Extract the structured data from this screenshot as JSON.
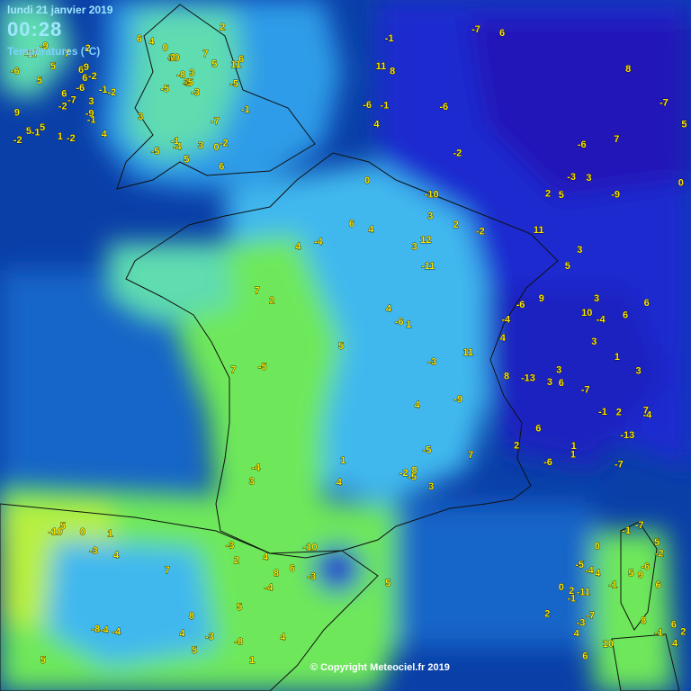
{
  "header": {
    "date": "lundi 21 janvier 2019",
    "time": "00:28",
    "unit_label": "Températures (°C)"
  },
  "footer": {
    "credit": "© Copyright Meteociel.fr 2019"
  },
  "colors": {
    "sea_deep": "#0a3fa8",
    "sea_mid": "#1565c8",
    "very_cold": "#1a2ad0",
    "cold": "#2f7fe8",
    "cool": "#41b8ee",
    "mild": "#5fdcb0",
    "warm_green": "#6ee85a",
    "lime": "#b8f03c",
    "label": "#ffe800"
  },
  "map_data": {
    "region": "France",
    "observations": [
      {
        "v": "5"
      },
      {
        "v": "5"
      },
      {
        "v": "4"
      },
      {
        "v": "2"
      },
      {
        "v": "4"
      },
      {
        "v": "6"
      },
      {
        "v": "5"
      },
      {
        "v": "7"
      },
      {
        "v": "3"
      },
      {
        "v": "7"
      },
      {
        "v": "8"
      },
      {
        "v": "6"
      },
      {
        "v": "5"
      },
      {
        "v": "4"
      },
      {
        "v": "3"
      },
      {
        "v": "8"
      },
      {
        "v": "2"
      },
      {
        "v": "3"
      },
      {
        "v": "5"
      },
      {
        "v": "9"
      },
      {
        "v": "10"
      },
      {
        "v": "11"
      },
      {
        "v": "11"
      },
      {
        "v": "12"
      },
      {
        "v": "10"
      },
      {
        "v": "8"
      },
      {
        "v": "6"
      },
      {
        "v": "4"
      },
      {
        "v": "5"
      },
      {
        "v": "6"
      },
      {
        "v": "4"
      },
      {
        "v": "3"
      },
      {
        "v": "4"
      },
      {
        "v": "5"
      },
      {
        "v": "6"
      },
      {
        "v": "3"
      },
      {
        "v": "5"
      },
      {
        "v": "7"
      },
      {
        "v": "6"
      },
      {
        "v": "4"
      },
      {
        "v": "1"
      },
      {
        "v": "2"
      },
      {
        "v": "-1"
      },
      {
        "v": "0"
      },
      {
        "v": "1"
      },
      {
        "v": "2"
      },
      {
        "v": "-4"
      },
      {
        "v": "-2"
      },
      {
        "v": "-1"
      },
      {
        "v": "0"
      },
      {
        "v": "2"
      },
      {
        "v": "3"
      },
      {
        "v": "4"
      },
      {
        "v": "4"
      },
      {
        "v": "5"
      },
      {
        "v": "4"
      },
      {
        "v": "-3"
      },
      {
        "v": "-6"
      },
      {
        "v": "-5"
      },
      {
        "v": "-7"
      },
      {
        "v": "-8"
      },
      {
        "v": "-9"
      },
      {
        "v": "-11"
      },
      {
        "v": "-7"
      },
      {
        "v": "-6"
      },
      {
        "v": "-5"
      },
      {
        "v": "-4"
      },
      {
        "v": "-3"
      },
      {
        "v": "-6"
      },
      {
        "v": "-7"
      },
      {
        "v": "-8"
      },
      {
        "v": "-6"
      },
      {
        "v": "-5"
      },
      {
        "v": "-4"
      },
      {
        "v": "-3"
      },
      {
        "v": "-2"
      },
      {
        "v": "-1"
      },
      {
        "v": "-5"
      },
      {
        "v": "-7"
      },
      {
        "v": "-6"
      },
      {
        "v": "-4"
      },
      {
        "v": "-10"
      },
      {
        "v": "-9"
      },
      {
        "v": "-6"
      },
      {
        "v": "-5"
      },
      {
        "v": "-7"
      },
      {
        "v": "-4"
      },
      {
        "v": "-6"
      },
      {
        "v": "-3"
      },
      {
        "v": "-2"
      },
      {
        "v": "-3"
      },
      {
        "v": "-1"
      },
      {
        "v": "-2"
      },
      {
        "v": "-3"
      },
      {
        "v": "-1"
      },
      {
        "v": "1"
      },
      {
        "v": "2"
      },
      {
        "v": "0"
      },
      {
        "v": "3"
      },
      {
        "v": "3"
      },
      {
        "v": "4"
      },
      {
        "v": "3"
      },
      {
        "v": "2"
      },
      {
        "v": "4"
      },
      {
        "v": "5"
      },
      {
        "v": "6"
      },
      {
        "v": "4"
      },
      {
        "v": "4"
      },
      {
        "v": "6"
      },
      {
        "v": "7"
      },
      {
        "v": "5"
      },
      {
        "v": "6"
      },
      {
        "v": "6"
      },
      {
        "v": "7"
      },
      {
        "v": "8"
      },
      {
        "v": "6"
      },
      {
        "v": "5"
      },
      {
        "v": "7"
      },
      {
        "v": "6"
      },
      {
        "v": "3"
      },
      {
        "v": "2"
      },
      {
        "v": "3"
      },
      {
        "v": "1"
      },
      {
        "v": "0"
      },
      {
        "v": "-1"
      },
      {
        "v": "-2"
      },
      {
        "v": "-4"
      },
      {
        "v": "-9"
      },
      {
        "v": "-11"
      },
      {
        "v": "-13"
      },
      {
        "v": "-10"
      },
      {
        "v": "-17"
      },
      {
        "v": "-5"
      },
      {
        "v": "-3"
      },
      {
        "v": "-1"
      },
      {
        "v": "-2"
      },
      {
        "v": "-6"
      },
      {
        "v": "-4"
      },
      {
        "v": "-2"
      },
      {
        "v": "-1"
      },
      {
        "v": "-5"
      },
      {
        "v": "-3"
      },
      {
        "v": "-4"
      },
      {
        "v": "-7"
      },
      {
        "v": "-3"
      },
      {
        "v": "-2"
      },
      {
        "v": "-1"
      },
      {
        "v": "0"
      },
      {
        "v": "3"
      },
      {
        "v": "5"
      },
      {
        "v": "7"
      },
      {
        "v": "8"
      },
      {
        "v": "6"
      },
      {
        "v": "8"
      },
      {
        "v": "10"
      },
      {
        "v": "11"
      },
      {
        "v": "11"
      },
      {
        "v": "9"
      },
      {
        "v": "5"
      },
      {
        "v": "3"
      },
      {
        "v": "2"
      },
      {
        "v": "-2"
      },
      {
        "v": "0"
      },
      {
        "v": "3"
      },
      {
        "v": "1"
      },
      {
        "v": "-4"
      },
      {
        "v": "-1"
      },
      {
        "v": "2"
      },
      {
        "v": "4"
      },
      {
        "v": "5"
      },
      {
        "v": "6"
      },
      {
        "v": "3"
      },
      {
        "v": "1"
      },
      {
        "v": "-1"
      },
      {
        "v": "0"
      },
      {
        "v": "2"
      },
      {
        "v": "4"
      },
      {
        "v": "1"
      },
      {
        "v": "3"
      },
      {
        "v": "5"
      },
      {
        "v": "-7"
      },
      {
        "v": "-7"
      },
      {
        "v": "-2"
      },
      {
        "v": "8"
      },
      {
        "v": "7"
      },
      {
        "v": "6"
      },
      {
        "v": "5"
      },
      {
        "v": "9"
      },
      {
        "v": "9"
      },
      {
        "v": "6"
      },
      {
        "v": "-10"
      },
      {
        "v": "-9"
      },
      {
        "v": "-13"
      },
      {
        "v": "-8"
      },
      {
        "v": "-6"
      },
      {
        "v": "-4"
      },
      {
        "v": "-5"
      },
      {
        "v": "-1"
      },
      {
        "v": "-2"
      },
      {
        "v": "1"
      }
    ]
  }
}
